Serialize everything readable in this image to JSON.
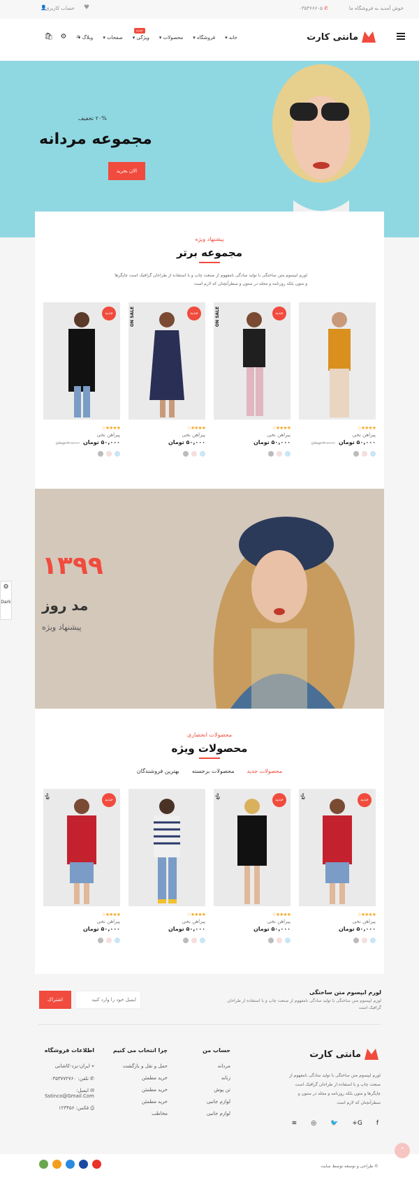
{
  "topbar": {
    "welcome": "خوش آمدید به فروشگاه ما",
    "phone": "۰۳۵۳۶۶۶۰۵",
    "account": "حساب کاربری"
  },
  "header": {
    "logo_text": "مانتی کارت",
    "nav": [
      {
        "label": "خانه"
      },
      {
        "label": "فروشگاه"
      },
      {
        "label": "محصولات"
      },
      {
        "label": "ویژگی",
        "badge": "جدید"
      },
      {
        "label": "صفحات"
      },
      {
        "label": "وبلاگ"
      }
    ]
  },
  "hero": {
    "subtitle": "۲۰% تخفیف",
    "title": "مجموعه مردانه",
    "button": "الان بخرید"
  },
  "section1": {
    "kicker": "پیشنهاد ویژه",
    "title": "مجموعه برتر",
    "description": "لورم ایپسوم متن ساختگی با تولید سادگی نامفهوم از صنعت چاپ و با استفاده از طراحان گرافیک است چاپگرها و متون بلکه روزنامه و مجله در ستون و سطرآنچنان که لازم است"
  },
  "products1": [
    {
      "name": "پیراهن نخی",
      "price": "۵۰,۰۰۰ تومان",
      "old": "۶۰,۰۰۰ تومان",
      "badge": "",
      "sale": ""
    },
    {
      "name": "پیراهن نخی",
      "price": "۵۰,۰۰۰ تومان",
      "old": "",
      "badge": "جدید",
      "sale": "ON SALE"
    },
    {
      "name": "پیراهن نخی",
      "price": "۵۰,۰۰۰ تومان",
      "old": "",
      "badge": "جدید",
      "sale": "ON SALE"
    },
    {
      "name": "پیراهن نخی",
      "price": "۵۰,۰۰۰ تومان",
      "old": "۶۰,۰۰۰ تومان",
      "badge": "جدید",
      "sale": ""
    }
  ],
  "banner": {
    "year": "۱۳۹۹",
    "title": "مد روز",
    "subtitle": "پیشنهاد ویژه"
  },
  "section2": {
    "kicker": "محصولات انحصاری",
    "title": "محصولات ویژه",
    "tabs": [
      "محصولات جدید",
      "محصولات برجسته",
      "بهترین فروشندگان"
    ]
  },
  "products2": [
    {
      "name": "پیراهن نخی",
      "price": "۵۰,۰۰۰ تومان",
      "badge": "جدید",
      "sale": "داغ"
    },
    {
      "name": "پیراهن نخی",
      "price": "۵۰,۰۰۰ تومان",
      "badge": "جدید",
      "sale": "داغ"
    },
    {
      "name": "پیراهن نخی",
      "price": "۵۰,۰۰۰ تومان",
      "badge": "",
      "sale": ""
    },
    {
      "name": "پیراهن نخی",
      "price": "۵۰,۰۰۰ تومان",
      "badge": "جدید",
      "sale": "داغ"
    }
  ],
  "side_widget": {
    "dark_label": "Dark"
  },
  "newsletter": {
    "title": "لورم ایپسوم متن ساختگی",
    "description": "لورم ایپسوم متن ساختگی با تولید سادگی نامفهوم از صنعت چاپ و با استفاده از طراحان گرافیک است",
    "placeholder": "ایمیل خود را وارد کنید",
    "button": "اشتراک"
  },
  "footer": {
    "logo_text": "مانتی کارت",
    "about": "لورم ایپسوم متن ساختگی با تولید سادگی نامفهوم از صنعت چاپ و با استفاده از طراحان گرافیک است چاپگرها و متون بلکه روزنامه و مجله در ستون و سطرآنچنان که لازم است",
    "col_account": {
      "title": "حساب من",
      "items": [
        "مردانه",
        "زنانه",
        "تن پوش",
        "لوازم جانبی",
        "لوازم جانبی"
      ]
    },
    "col_why": {
      "title": "چرا انتخاب می کنیم",
      "items": [
        "حمل و نقل و بازگشت",
        "خرید مطمئن",
        "خرید مطمئن",
        "خرید مطمئن",
        "مخاطب"
      ]
    },
    "col_info": {
      "title": "اطلاعات فروشگاه",
      "address": "ایران-یزد-کاشانی",
      "phone": "تلفن: ۰۳۵۳۷۷۲۷۶۰",
      "email_label": "ایمیل:",
      "email": "Sstinco@Gmail.Com",
      "fax": "فکس: ۱۲۳۴۵۶"
    },
    "copyright": "© طراحی و توسعه توسط سایت"
  },
  "colors": {
    "accent": "#f04b3d",
    "hero_bg": "#8fd8e2"
  }
}
